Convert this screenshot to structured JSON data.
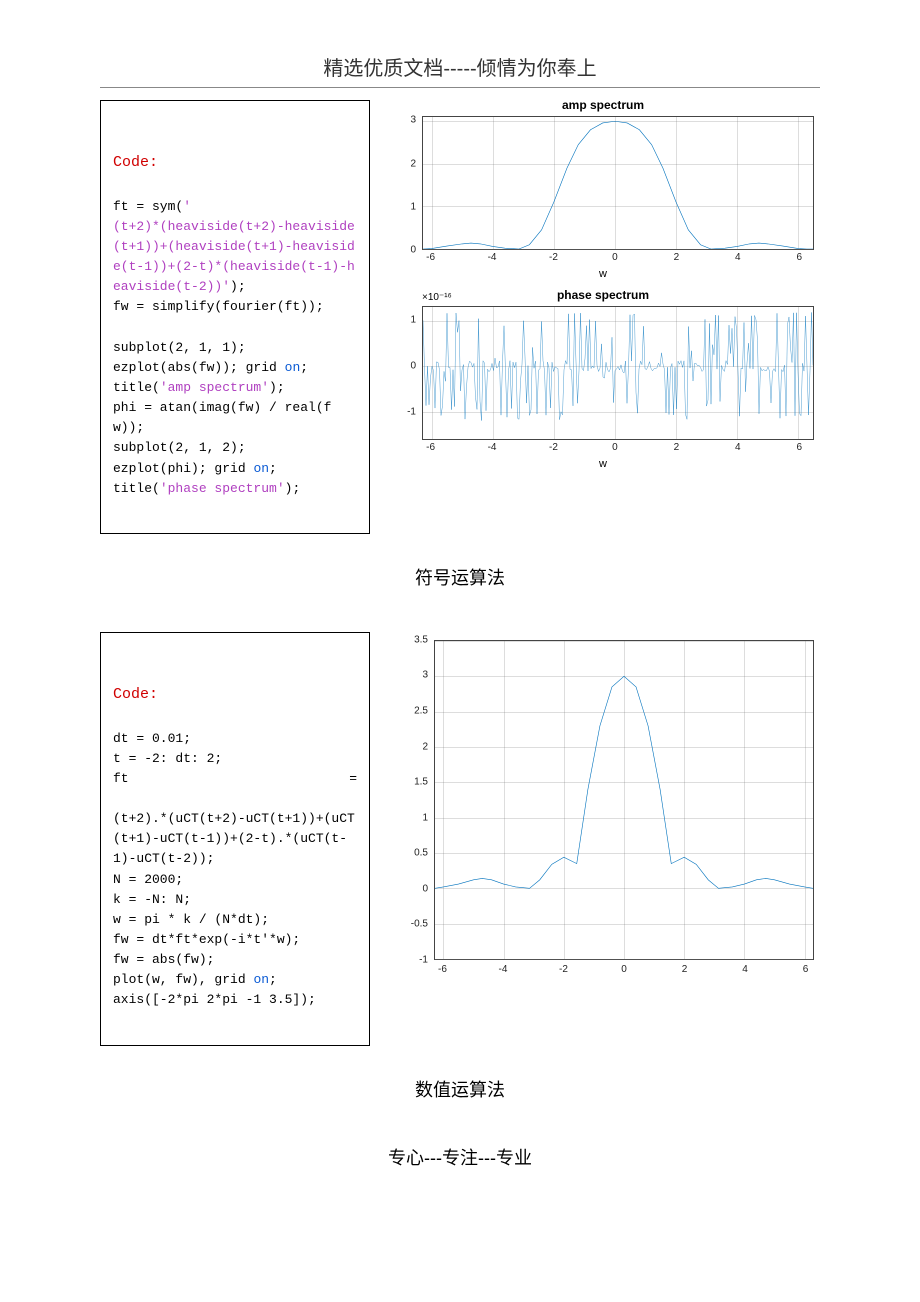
{
  "header": {
    "text": "精选优质文档-----倾情为你奉上"
  },
  "footer": {
    "text": "专心---专注---专业"
  },
  "section1": {
    "code_label": "Code:",
    "code_line1a": "ft = sym(",
    "code_line1b": "'",
    "code_str": "(t+2)*(heaviside(t+2)-heaviside(t+1))+(heaviside(t+1)-heaviside(t-1))+(2-t)*(heaviside(t-1)-heaviside(t-2))'",
    "code_line1c": ");",
    "code_line2": "fw = simplify(fourier(ft));",
    "code_blank": "",
    "code_line3": "subplot(2, 1, 1);",
    "code_line4a": "ezplot(abs(fw)); grid ",
    "code_line4b": "on",
    "code_line4c": ";",
    "code_line5a": "title(",
    "code_line5b": "'amp spectrum'",
    "code_line5c": ");",
    "code_line6": "phi = atan(imag(fw) / real(fw));",
    "code_line7": "subplot(2, 1, 2);",
    "code_line8a": "ezplot(phi); grid ",
    "code_line8b": "on",
    "code_line8c": ";",
    "code_line9a": "title(",
    "code_line9b": "'phase spectrum'",
    "code_line9c": ");",
    "caption": "符号运算法"
  },
  "section2": {
    "code_label": "Code:",
    "l1": "dt = 0.01;",
    "l2": "t = -2: dt: 2;",
    "l3a": "ft",
    "l3b": "=",
    "l4": "(t+2).*(uCT(t+2)-uCT(t+1))+(uCT(t+1)-uCT(t-1))+(2-t).*(uCT(t-1)-uCT(t-2));",
    "l5": "N = 2000;",
    "l6": "k = -N: N;",
    "l7": "w = pi * k / (N*dt);",
    "l8": "fw = dt*ft*exp(-i*t'*w);",
    "l9": "fw = abs(fw);",
    "l10a": "plot(w, fw), grid ",
    "l10b": "on",
    "l10c": ";",
    "l11": "axis([-2*pi 2*pi -1 3.5]);",
    "caption": "数值运算法"
  },
  "chart_data": [
    {
      "type": "line",
      "title": "amp spectrum",
      "xlabel": "w",
      "xlim": [
        -6.28,
        6.48
      ],
      "ylim": [
        0,
        3.1
      ],
      "xticks": [
        -6,
        -4,
        -2,
        0,
        2,
        4,
        6
      ],
      "yticks": [
        0,
        1,
        2,
        3
      ],
      "series": [
        {
          "name": "abs(fw)",
          "x": [
            -6.28,
            -6,
            -5.5,
            -5,
            -4.71,
            -4.4,
            -4,
            -3.6,
            -3.14,
            -2.8,
            -2.4,
            -2,
            -1.57,
            -1.2,
            -0.8,
            -0.4,
            0,
            0.4,
            0.8,
            1.2,
            1.57,
            2,
            2.4,
            2.8,
            3.14,
            3.6,
            4,
            4.4,
            4.71,
            5,
            5.5,
            6,
            6.28,
            6.48
          ],
          "values": [
            0,
            0.01,
            0.07,
            0.12,
            0.14,
            0.12,
            0.06,
            0.02,
            0,
            0.1,
            0.45,
            1.1,
            1.9,
            2.45,
            2.8,
            2.96,
            3,
            2.96,
            2.8,
            2.45,
            1.9,
            1.1,
            0.45,
            0.1,
            0,
            0.02,
            0.06,
            0.12,
            0.14,
            0.12,
            0.07,
            0.01,
            0,
            0
          ]
        }
      ]
    },
    {
      "type": "line",
      "title": "phase spectrum",
      "xlabel": "w",
      "exp_label": "×10⁻¹⁶",
      "xlim": [
        -6.28,
        6.48
      ],
      "ylim": [
        -1.6,
        1.3
      ],
      "xticks": [
        -6,
        -4,
        -2,
        0,
        2,
        4,
        6
      ],
      "yticks": [
        -1,
        0,
        1
      ],
      "note": "noise-like near-zero numerical phase; values oscillate randomly in ±1.2e-16"
    },
    {
      "type": "line",
      "title": "",
      "xlabel": "",
      "xlim": [
        -6.28,
        6.28
      ],
      "ylim": [
        -1,
        3.5
      ],
      "xticks": [
        -6,
        -4,
        -2,
        0,
        2,
        4,
        6
      ],
      "yticks": [
        -1,
        -0.5,
        0,
        0.5,
        1,
        1.5,
        2,
        2.5,
        3,
        3.5
      ],
      "series": [
        {
          "name": "|fw|",
          "x": [
            -6.28,
            -6,
            -5.5,
            -5,
            -4.71,
            -4.4,
            -4,
            -3.6,
            -3.14,
            -2.8,
            -2.4,
            -2,
            -1.57,
            -1.2,
            -0.8,
            -0.4,
            0,
            0.4,
            0.8,
            1.2,
            1.57,
            2,
            2.4,
            2.8,
            3.14,
            3.6,
            4,
            4.4,
            4.71,
            5,
            5.5,
            6,
            6.28
          ],
          "values": [
            0,
            0.02,
            0.06,
            0.12,
            0.14,
            0.12,
            0.06,
            0.02,
            0,
            0.12,
            0.34,
            0.44,
            0.35,
            1.4,
            2.3,
            2.85,
            3,
            2.85,
            2.3,
            1.4,
            0.35,
            0.44,
            0.34,
            0.12,
            0,
            0.02,
            0.06,
            0.12,
            0.14,
            0.12,
            0.06,
            0.02,
            0
          ]
        }
      ]
    }
  ]
}
